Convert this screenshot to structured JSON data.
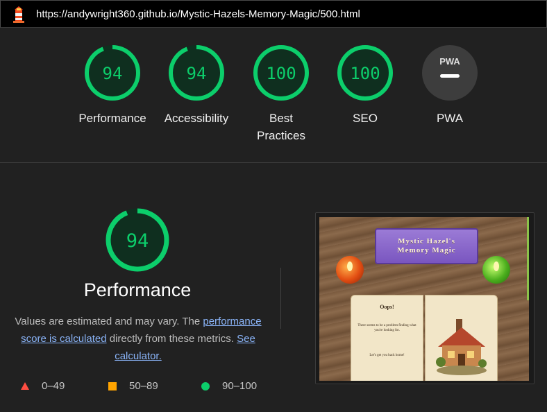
{
  "url_bar": {
    "url": "https://andywright360.github.io/Mystic-Hazels-Memory-Magic/500.html",
    "logo_icon": "lighthouse-icon"
  },
  "categories": [
    {
      "label": "Performance",
      "score": "94",
      "value": 94,
      "color": "#0cce6b"
    },
    {
      "label": "Accessibility",
      "score": "94",
      "value": 94,
      "color": "#0cce6b"
    },
    {
      "label": "Best Practices",
      "score": "100",
      "value": 100,
      "color": "#0cce6b"
    },
    {
      "label": "SEO",
      "score": "100",
      "value": 100,
      "color": "#0cce6b"
    },
    {
      "label": "PWA",
      "badge_text": "PWA",
      "color": "#3d3d3d"
    }
  ],
  "performance": {
    "score": "94",
    "value": 94,
    "title": "Performance",
    "desc_prefix": "Values are estimated and may vary. The ",
    "link_score": "performance score is calculated",
    "desc_middle": " directly from these metrics. ",
    "link_calc": "See calculator."
  },
  "legend": [
    {
      "range": "0–49",
      "color": "#ff4e42",
      "shape": "triangle"
    },
    {
      "range": "50–89",
      "color": "#ffa400",
      "shape": "square"
    },
    {
      "range": "90–100",
      "color": "#0cce6b",
      "shape": "circle"
    }
  ],
  "screenshot": {
    "banner_line1": "Mystic Hazel's",
    "banner_line2": "Memory Magic",
    "heading": "Oops!",
    "message": "There seems to be a problem finding what you're looking for.",
    "cta": "Let's get you back home!"
  }
}
